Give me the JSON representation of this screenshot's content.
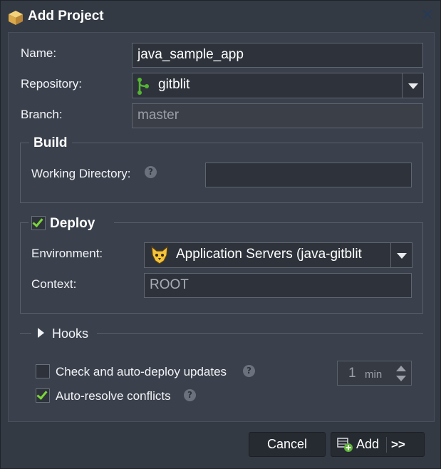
{
  "dialog": {
    "title": "Add Project",
    "close_icon": "close-icon",
    "title_icon": "package-icon"
  },
  "form": {
    "name_label": "Name:",
    "name_value": "java_sample_app",
    "repository_label": "Repository:",
    "repository_value": "gitblit",
    "repository_icon": "git-branch-icon",
    "branch_label": "Branch:",
    "branch_value": "master"
  },
  "build": {
    "legend": "Build",
    "working_dir_label": "Working Directory:",
    "working_dir_value": ""
  },
  "deploy": {
    "legend": "Deploy",
    "checked": true,
    "environment_label": "Environment:",
    "environment_value": "Application Servers (java-gitblit",
    "environment_icon": "tomcat-icon",
    "context_label": "Context:",
    "context_value": "ROOT"
  },
  "hooks": {
    "label": "Hooks"
  },
  "options": {
    "auto_deploy_label": "Check and auto-deploy updates",
    "auto_deploy_checked": false,
    "interval_value": "1",
    "interval_unit": "min",
    "auto_resolve_label": "Auto-resolve conflicts",
    "auto_resolve_checked": true
  },
  "buttons": {
    "cancel_label": "Cancel",
    "add_label": "Add",
    "add_more": ">>"
  },
  "colors": {
    "accent_check": "#7bd63a",
    "git_icon": "#55b534",
    "background": "#3b414c"
  }
}
